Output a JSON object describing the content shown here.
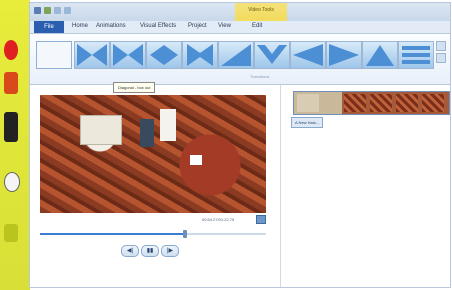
{
  "window": {
    "context_tab_group": "Video Tools",
    "accent": "#2a5fb0"
  },
  "ribbon_tabs": [
    "File",
    "Home",
    "Animations",
    "Visual Effects",
    "Project",
    "View",
    "Edit"
  ],
  "ribbon": {
    "group_label": "Transitions",
    "tooltip": "Diagonal - box out",
    "transition_icons": [
      "no-transition",
      "diagonal-box-out",
      "diagonal-cross",
      "diamond",
      "diagonal-x",
      "sweep-up",
      "chevron-down",
      "arrow-left",
      "arrow-right",
      "triangle",
      "blinds"
    ]
  },
  "preview": {
    "time": "00:54.27/01:22.75"
  },
  "transport": {
    "prev_label": "◀|",
    "play_label": "▮▮",
    "next_label": "|▶"
  },
  "storyboard": {
    "caption_chip": "A New Halo..."
  },
  "seek": {
    "fraction": 0.64
  }
}
